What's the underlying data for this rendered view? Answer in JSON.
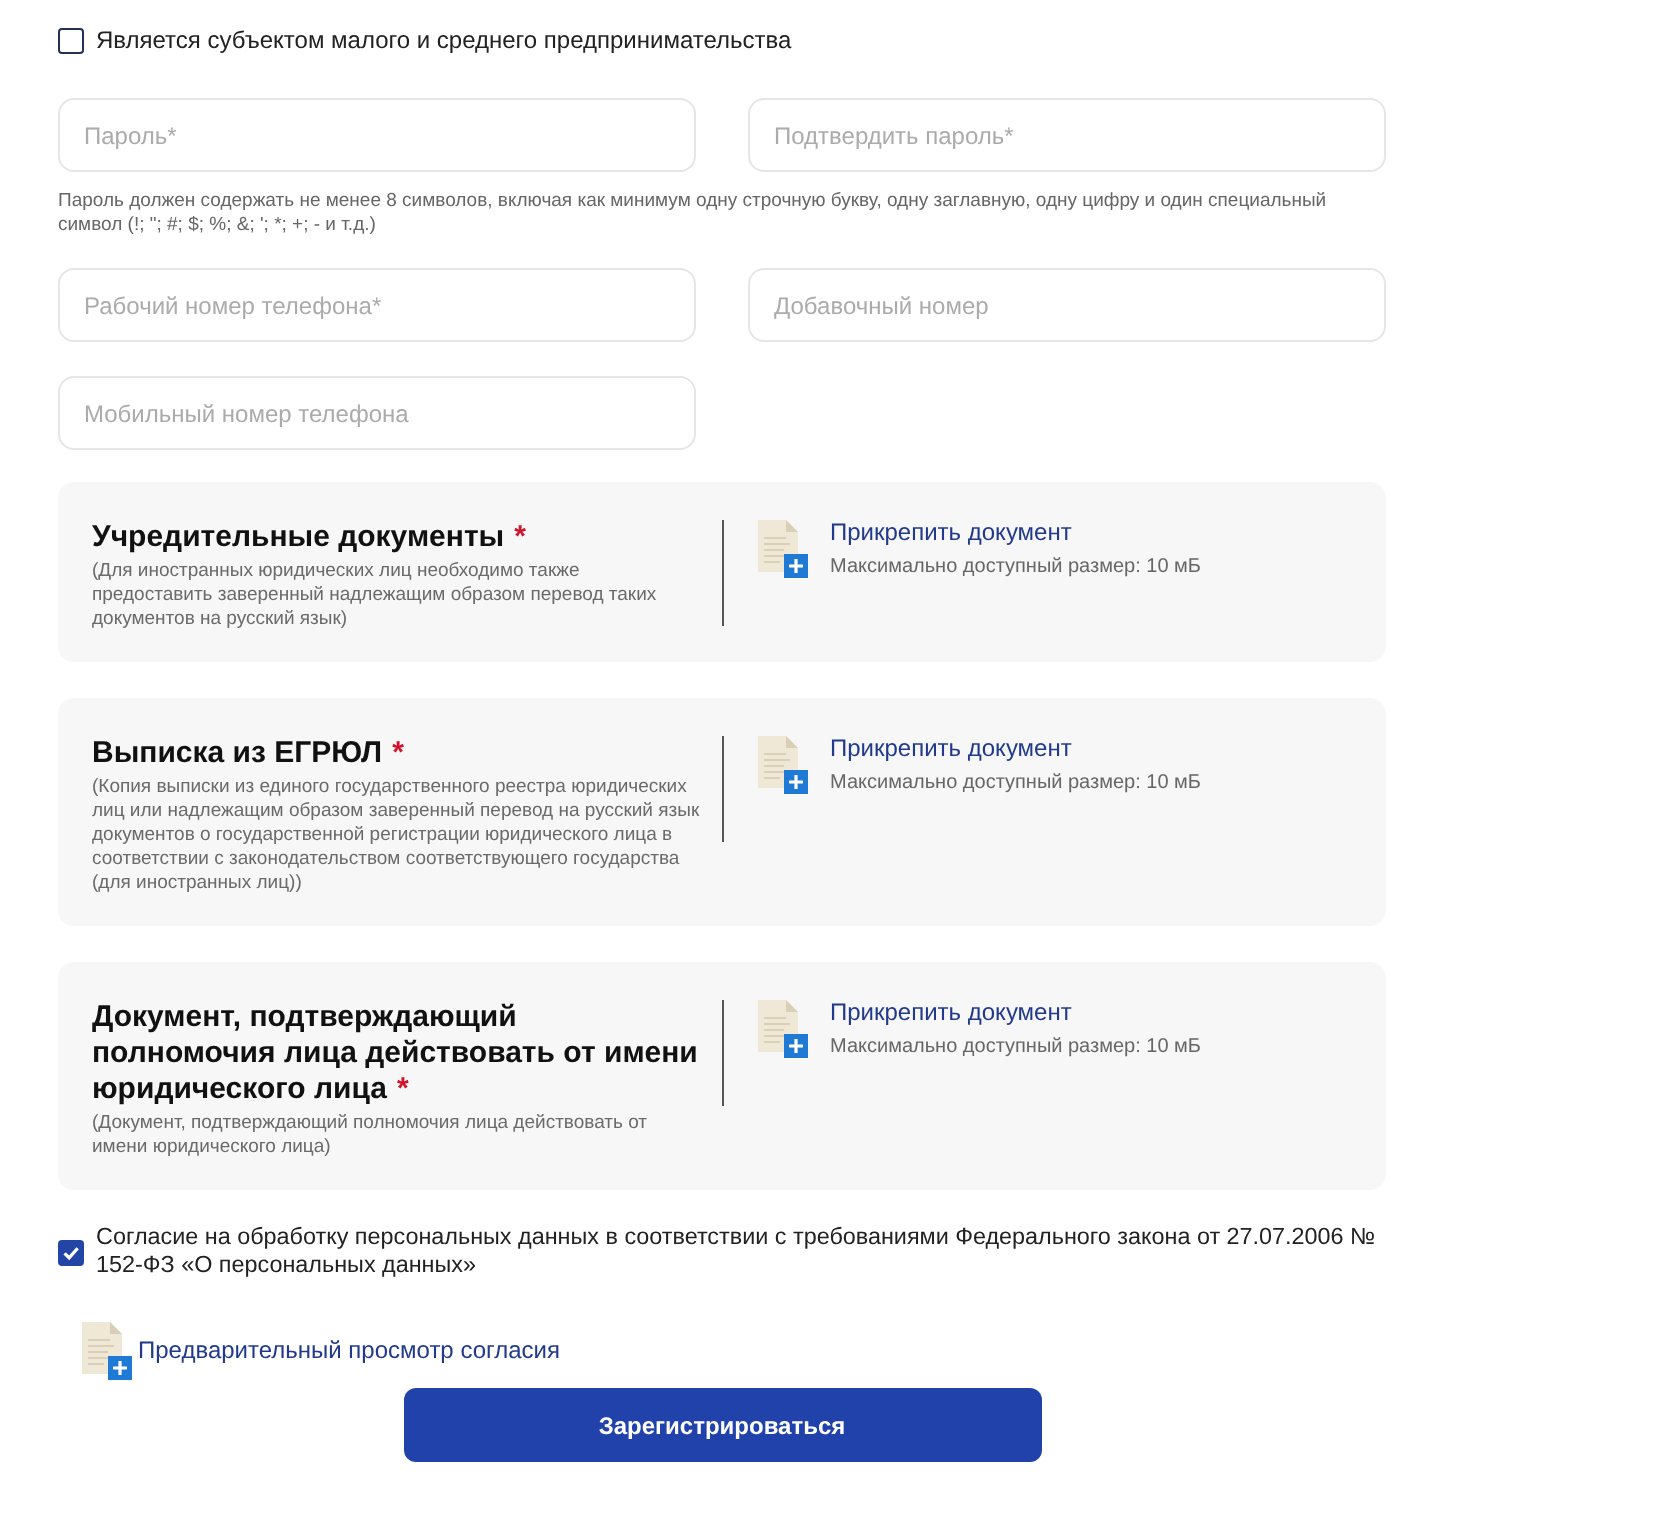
{
  "sme_checkbox": {
    "label": "Является субъектом малого и среднего предпринимательства",
    "checked": false
  },
  "password_fields": [
    {
      "placeholder": "Пароль*"
    },
    {
      "placeholder": "Подтвердить пароль*"
    }
  ],
  "password_hint": "Пароль должен содержать не менее 8 символов, включая как минимум одну строчную букву, одну заглавную, одну цифру и один специальный символ (!; \"; #; $; %; &; '; *; +; - и т.д.)",
  "phone_fields": [
    {
      "placeholder": "Рабочий номер телефона*"
    },
    {
      "placeholder": "Добавочный номер"
    },
    {
      "placeholder": "Мобильный номер телефона"
    }
  ],
  "documents": [
    {
      "title": "Учредительные документы",
      "required_mark": "*",
      "description": "(Для иностранных юридических лиц необходимо также предоставить заверенный надлежащим образом перевод таких документов на русский язык)",
      "attach_link": "Прикрепить документ",
      "max_size": "Максимально доступный размер: 10 мБ"
    },
    {
      "title": "Выписка из ЕГРЮЛ",
      "required_mark": "*",
      "description": "(Копия выписки из единого государственного реестра юридических лиц или надлежащим образом заверенный перевод на русский язык документов о государственной регистрации юридического лица в соответствии с законодательством соответствующего государства (для иностранных лиц))",
      "attach_link": "Прикрепить документ",
      "max_size": "Максимально доступный размер: 10 мБ"
    },
    {
      "title": "Документ, подтверждающий полномочия лица действовать от имени юридического лица",
      "required_mark": "*",
      "description": "(Документ, подтверждающий полномочия лица действовать от имени юридического лица)",
      "attach_link": "Прикрепить документ",
      "max_size": "Максимально доступный размер: 10 мБ"
    }
  ],
  "consent": {
    "text": "Согласие на обработку персональных данных в соответствии с требованиями Федерального закона от 27.07.2006 № 152-ФЗ «О персональных данных»",
    "checked": true
  },
  "consent_preview_link": "Предварительный просмотр согласия",
  "submit_button": "Зарегистрироваться"
}
